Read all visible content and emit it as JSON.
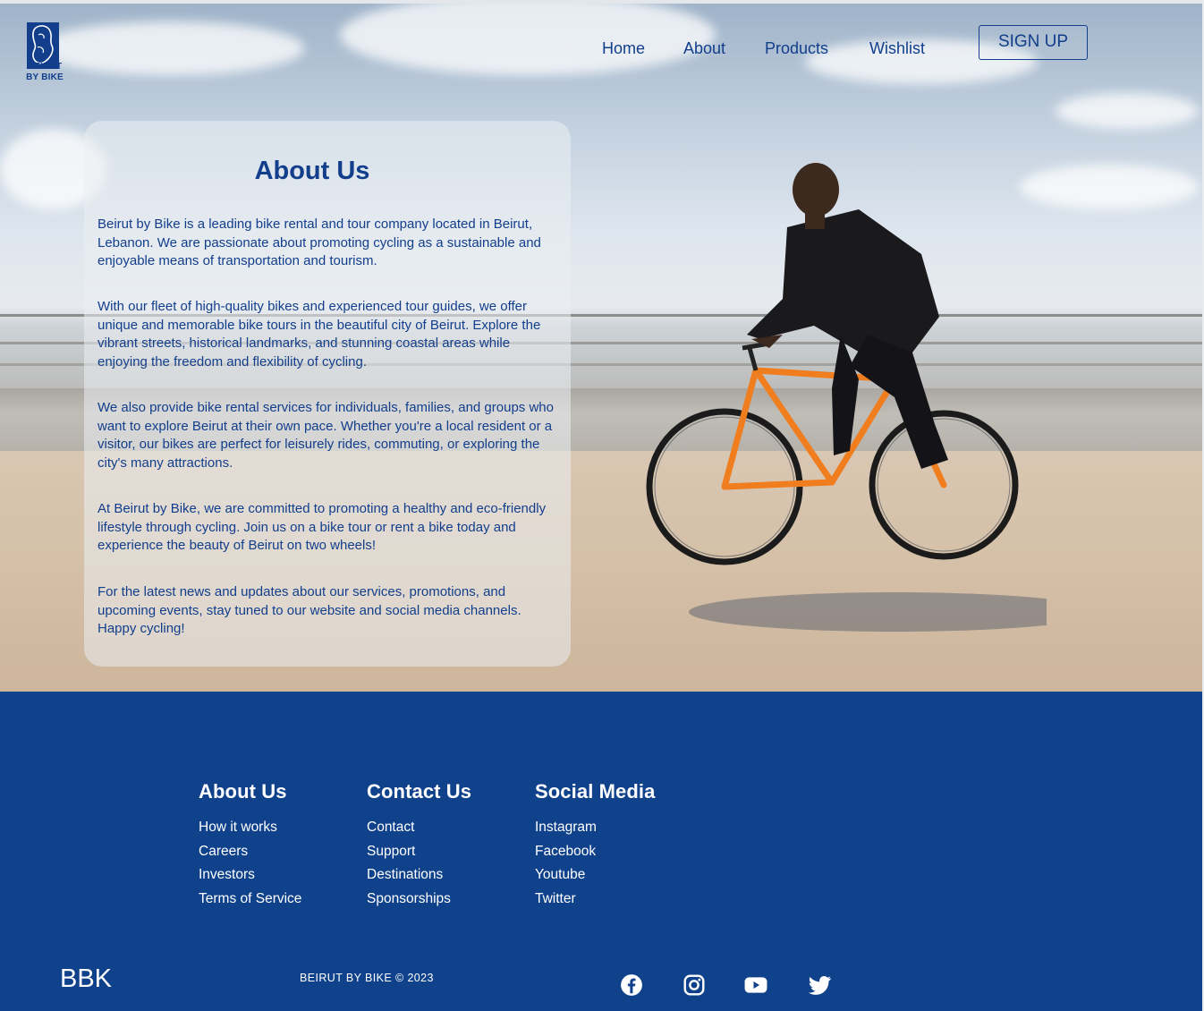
{
  "brand": {
    "logo_line1": "BEIRUT",
    "logo_line2": "BY BIKE"
  },
  "nav": {
    "items": [
      "Home",
      "About",
      "Products",
      "Wishlist"
    ],
    "signup_label": "SIGN UP"
  },
  "about": {
    "title": "About Us",
    "paragraphs": [
      "Beirut by Bike is a leading bike rental and tour company located in Beirut, Lebanon. We are passionate about promoting cycling as a sustainable and enjoyable means of transportation and tourism.",
      "With our fleet of high-quality bikes and experienced tour guides, we offer unique and memorable bike tours in the beautiful city of Beirut. Explore the vibrant streets, historical landmarks, and stunning coastal areas while enjoying the freedom and flexibility of cycling.",
      "We also provide bike rental services for individuals, families, and groups who want to explore Beirut at their own pace. Whether you're a local resident or a visitor, our bikes are perfect for leisurely rides, commuting, or exploring the city's many attractions.",
      "At Beirut by Bike, we are committed to promoting a healthy and eco-friendly lifestyle through cycling. Join us on a bike tour or rent a bike today and experience the beauty of Beirut on two wheels!",
      "For the latest news and updates about our services, promotions, and upcoming events, stay tuned to our website and social media channels. Happy cycling!"
    ]
  },
  "footer": {
    "columns": [
      {
        "title": "About Us",
        "links": [
          "How it works",
          "Careers",
          "Investors",
          "Terms of Service"
        ]
      },
      {
        "title": "Contact Us",
        "links": [
          "Contact",
          "Support",
          "Destinations",
          "Sponsorships"
        ]
      },
      {
        "title": "Social Media",
        "links": [
          "Instagram",
          "Facebook",
          "Youtube",
          "Twitter"
        ]
      }
    ],
    "brand": "BBK",
    "copyright": "BEIRUT BY BIKE © 2023",
    "social_icons": [
      "facebook-icon",
      "instagram-icon",
      "youtube-icon",
      "twitter-icon"
    ]
  },
  "colors": {
    "brand_blue": "#123e8c",
    "footer_bg": "#10428c"
  }
}
